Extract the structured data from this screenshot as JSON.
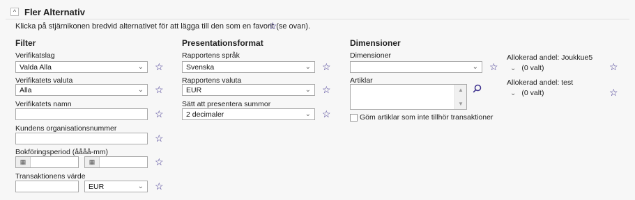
{
  "header": {
    "title": "Fler Alternativ",
    "hint": "Klicka på stjärnikonen bredvid alternativet för att lägga till den som en favorit (se ovan).",
    "collapse_icon": "^"
  },
  "icons": {
    "star": "☆",
    "chevron": "⌄",
    "calendar": "▦",
    "search": "⌕",
    "up": "▲",
    "down": "▼"
  },
  "filter": {
    "title": "Filter",
    "voucher_type_label": "Verifikatslag",
    "voucher_type_value": "Valda Alla",
    "voucher_currency_label": "Verifikatets valuta",
    "voucher_currency_value": "Alla",
    "voucher_name_label": "Verifikatets namn",
    "org_number_label": "Kundens organisationsnummer",
    "period_label": "Bokföringsperiod (åååå-mm)",
    "transaction_value_label": "Transaktionens värde",
    "transaction_currency_value": "EUR"
  },
  "presentation": {
    "title": "Presentationsformat",
    "language_label": "Rapportens språk",
    "language_value": "Svenska",
    "currency_label": "Rapportens valuta",
    "currency_value": "EUR",
    "sum_format_label": "Sätt att presentera summor",
    "sum_format_value": "2 decimaler"
  },
  "dimensions": {
    "title": "Dimensioner",
    "dimensions_label": "Dimensioner",
    "dimensions_value": "",
    "articles_label": "Artiklar",
    "hide_articles_label": "Göm artiklar som inte tillhör transaktioner"
  },
  "allocations": {
    "joukkue5_label": "Allokerad andel: Joukkue5",
    "joukkue5_value": "(0 valt)",
    "test_label": "Allokerad andel: test",
    "test_value": "(0 valt)"
  }
}
